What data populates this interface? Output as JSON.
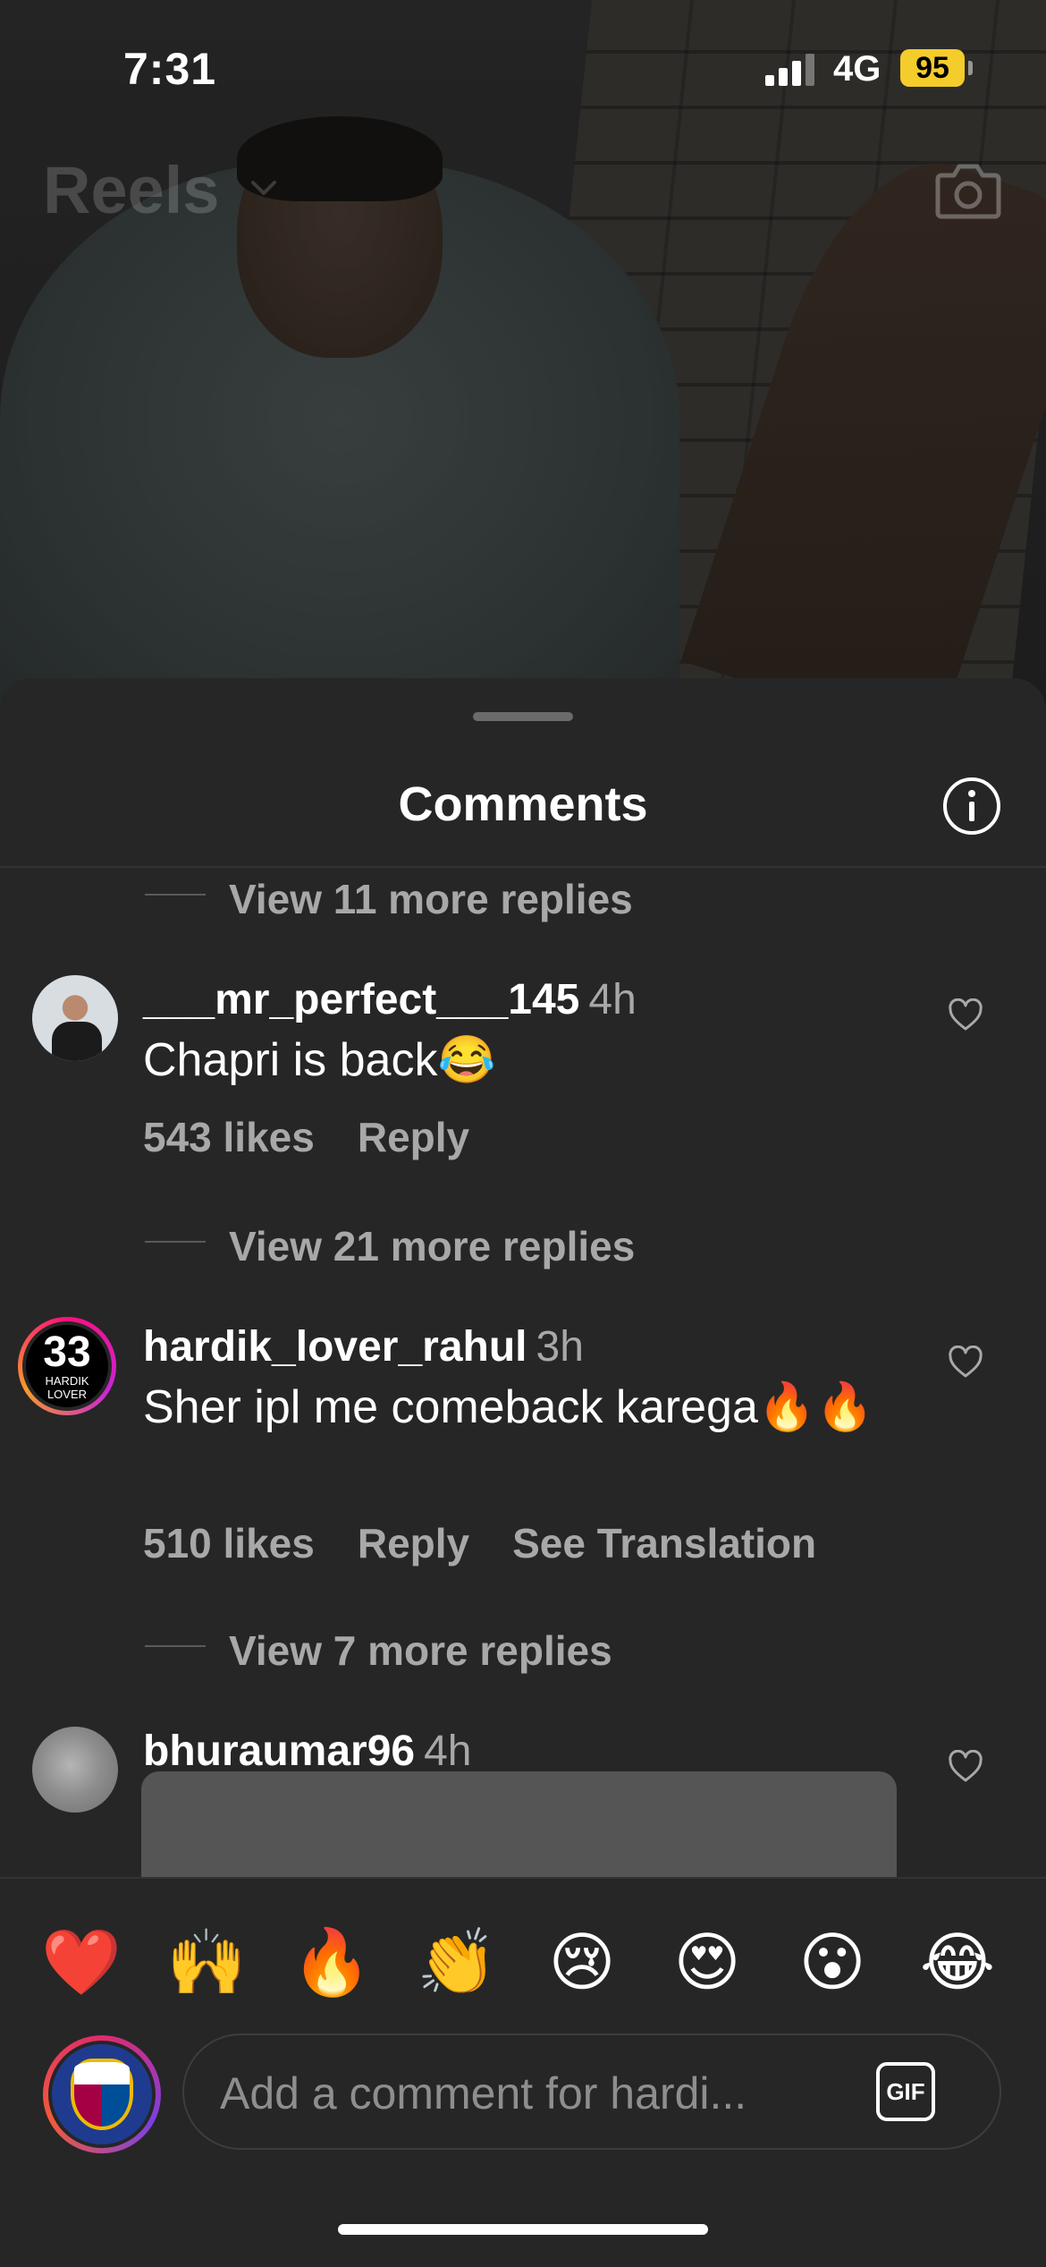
{
  "status_bar": {
    "time": "7:31",
    "network": "4G",
    "battery": "95"
  },
  "header": {
    "title": "Reels"
  },
  "sheet": {
    "title": "Comments"
  },
  "comments": {
    "view_more_1": "View 11 more replies",
    "items": [
      {
        "username": "___mr_perfect___145",
        "time": "4h",
        "text": "Chapri is back😂",
        "likes": "543 likes",
        "reply": "Reply",
        "view_more": "View 21 more replies"
      },
      {
        "username": "hardik_lover_rahul",
        "time": "3h",
        "text": "Sher ipl me comeback karega🔥🔥",
        "likes": "510 likes",
        "reply": "Reply",
        "translate": "See Translation",
        "avatar_number": "33",
        "avatar_label": "HARDIK LOVER",
        "view_more": "View 7 more replies"
      },
      {
        "username": "bhuraumar96",
        "time": "4h"
      }
    ]
  },
  "reactions": [
    "❤️",
    "🙌",
    "🔥",
    "👏",
    "😢",
    "😍",
    "😮",
    "😂"
  ],
  "composer": {
    "placeholder": "Add a comment for hardi...",
    "gif_label": "GIF"
  },
  "colors": {
    "sheet_bg": "#262626",
    "muted_text": "#a8a8a8",
    "battery": "#f4cc2b"
  }
}
